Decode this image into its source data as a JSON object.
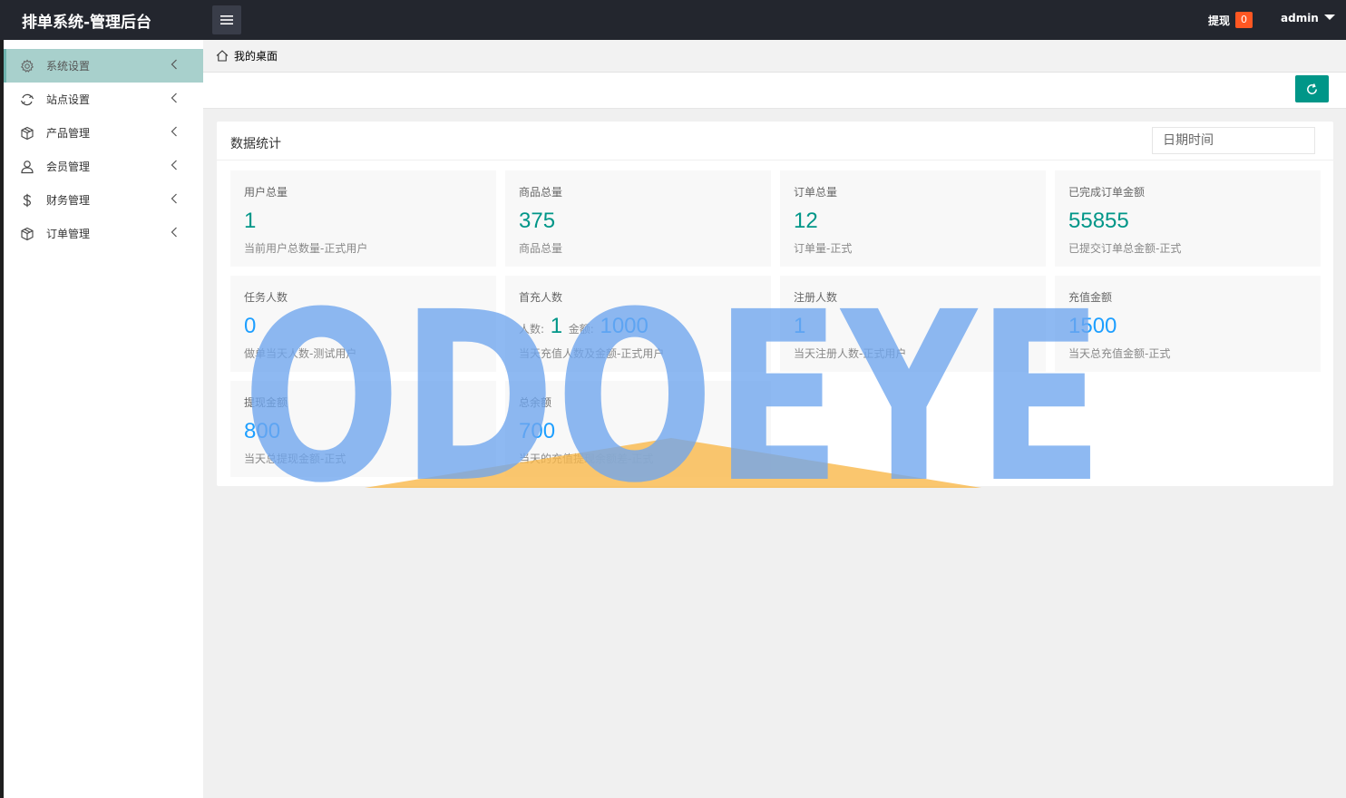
{
  "header": {
    "title": "排单系统-管理后台",
    "withdraw_label": "提现",
    "withdraw_count": "0",
    "user_name": "admin"
  },
  "sidebar": {
    "items": [
      {
        "label": "系统设置",
        "icon": "gear-icon",
        "active": true
      },
      {
        "label": "站点设置",
        "icon": "sync-icon",
        "active": false
      },
      {
        "label": "产品管理",
        "icon": "box-icon",
        "active": false
      },
      {
        "label": "会员管理",
        "icon": "user-icon",
        "active": false
      },
      {
        "label": "财务管理",
        "icon": "dollar-icon",
        "active": false
      },
      {
        "label": "订单管理",
        "icon": "box-icon",
        "active": false
      }
    ]
  },
  "tabs": [
    {
      "label": "我的桌面",
      "icon": "home-icon"
    }
  ],
  "card": {
    "title": "数据统计",
    "date_placeholder": "日期时间"
  },
  "stats": [
    {
      "label": "用户总量",
      "value": "1",
      "desc": "当前用户总数量-正式用户"
    },
    {
      "label": "商品总量",
      "value": "375",
      "desc": "商品总量"
    },
    {
      "label": "订单总量",
      "value": "12",
      "desc": "订单量-正式"
    },
    {
      "label": "已完成订单金额",
      "value": "55855",
      "desc": "已提交订单总金额-正式"
    },
    {
      "label": "任务人数",
      "value": "0",
      "desc": "做单当天人数-测试用户"
    },
    {
      "label": "首充人数",
      "count_label": "人数:",
      "count": "1",
      "amount_label": "金额:",
      "amount": "1000",
      "desc": "当天充值人数及金额-正式用户"
    },
    {
      "label": "注册人数",
      "value": "1",
      "desc": "当天注册人数-正式用户"
    },
    {
      "label": "充值金额",
      "value": "1500",
      "desc": "当天总充值金额-正式"
    },
    {
      "label": "提现金额",
      "value": "800",
      "desc": "当天总提现金额-正式"
    },
    {
      "label": "总余额",
      "value": "700",
      "desc": "当天的充值提现余额差-正式"
    }
  ],
  "watermark": {
    "text": "ODOEYE",
    "color": "#6fa6ef",
    "roof_color": "#f9b84a"
  },
  "colors": {
    "header_bg": "#23262e",
    "accent": "#009688",
    "active_item_bg": "#a8d0cc",
    "badge": "#ff5722"
  }
}
